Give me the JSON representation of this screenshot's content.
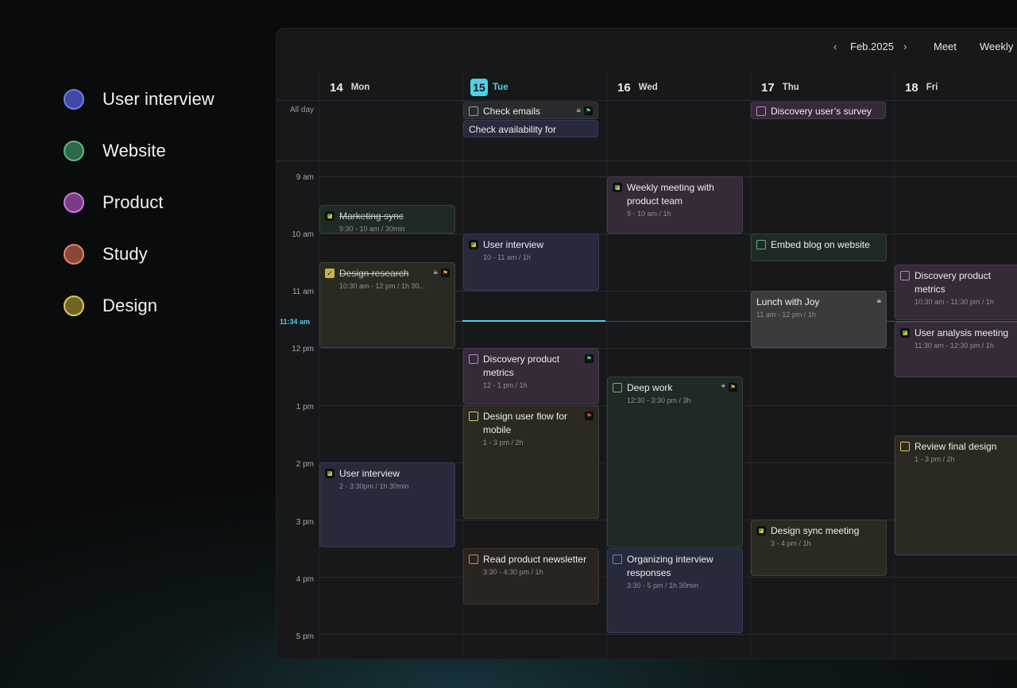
{
  "legend": [
    {
      "label": "User interview",
      "color": "#3f4aa8",
      "border": "#6f7ee0"
    },
    {
      "label": "Website",
      "color": "#2d6a47",
      "border": "#5fb582"
    },
    {
      "label": "Product",
      "color": "#7a3d84",
      "border": "#c97ad6"
    },
    {
      "label": "Study",
      "color": "#8a4636",
      "border": "#e08465"
    },
    {
      "label": "Design",
      "color": "#6f6624",
      "border": "#d8c95a"
    }
  ],
  "toolbar": {
    "month": "Feb.2025",
    "meet": "Meet",
    "view": "Weekly"
  },
  "days": [
    {
      "num": "14",
      "name": "Mon"
    },
    {
      "num": "15",
      "name": "Tue"
    },
    {
      "num": "16",
      "name": "Wed"
    },
    {
      "num": "17",
      "name": "Thu"
    },
    {
      "num": "18",
      "name": "Fri"
    }
  ],
  "allday_label": "All day",
  "times": [
    "9 am",
    "10 am",
    "11 am",
    "12 pm",
    "1 pm",
    "2 pm",
    "3 pm",
    "4 pm",
    "5 pm"
  ],
  "now_label": "11:34 am",
  "events": {
    "check_emails": {
      "title": "Check emails"
    },
    "check_availability": {
      "title": "Check availability for interview"
    },
    "discovery_survey": {
      "title": "Discovery user’s survey"
    },
    "marketing_sync": {
      "title": "Marketing sync",
      "time": "9:30 - 10 am / 30min"
    },
    "design_research": {
      "title": "Design research",
      "time": "10:30 am - 12 pm / 1h 30..."
    },
    "user_interview_mon": {
      "title": "User interview",
      "time": "2 - 3:30pm / 1h 30min"
    },
    "user_interview_tue": {
      "title": "User interview",
      "time": "10 - 11 am / 1h"
    },
    "discovery_metrics_tue": {
      "title": "Discovery product metrics",
      "time": "12 - 1 pm / 1h"
    },
    "design_flow": {
      "title": "Design user flow for mobile",
      "time": "1 - 3 pm / 2h"
    },
    "newsletter": {
      "title": "Read product newsletter",
      "time": "3:30 - 4:30 pm / 1h"
    },
    "weekly_meeting": {
      "title": "Weekly meeting with product team",
      "time": "9 - 10 am / 1h"
    },
    "deep_work": {
      "title": "Deep work",
      "time": "12:30 - 3:30 pm / 3h"
    },
    "organizing": {
      "title": "Organizing interview responses",
      "time": "3:30 - 5 pm / 1h 30min"
    },
    "embed_blog": {
      "title": "Embed blog on website"
    },
    "lunch": {
      "title": "Lunch with Joy",
      "time": "11 am - 12 pm / 1h"
    },
    "design_sync": {
      "title": "Design sync meeting",
      "time": "3 - 4 pm / 1h"
    },
    "discovery_metrics_fri": {
      "title": "Discovery product metrics",
      "time": "10:30 am - 11:30 pm / 1h"
    },
    "user_analysis": {
      "title": "User analysis meeting",
      "time": "11:30 am - 12:30 pm / 1h"
    },
    "review_design": {
      "title": "Review final design",
      "time": "1 - 3 pm / 2h"
    }
  }
}
